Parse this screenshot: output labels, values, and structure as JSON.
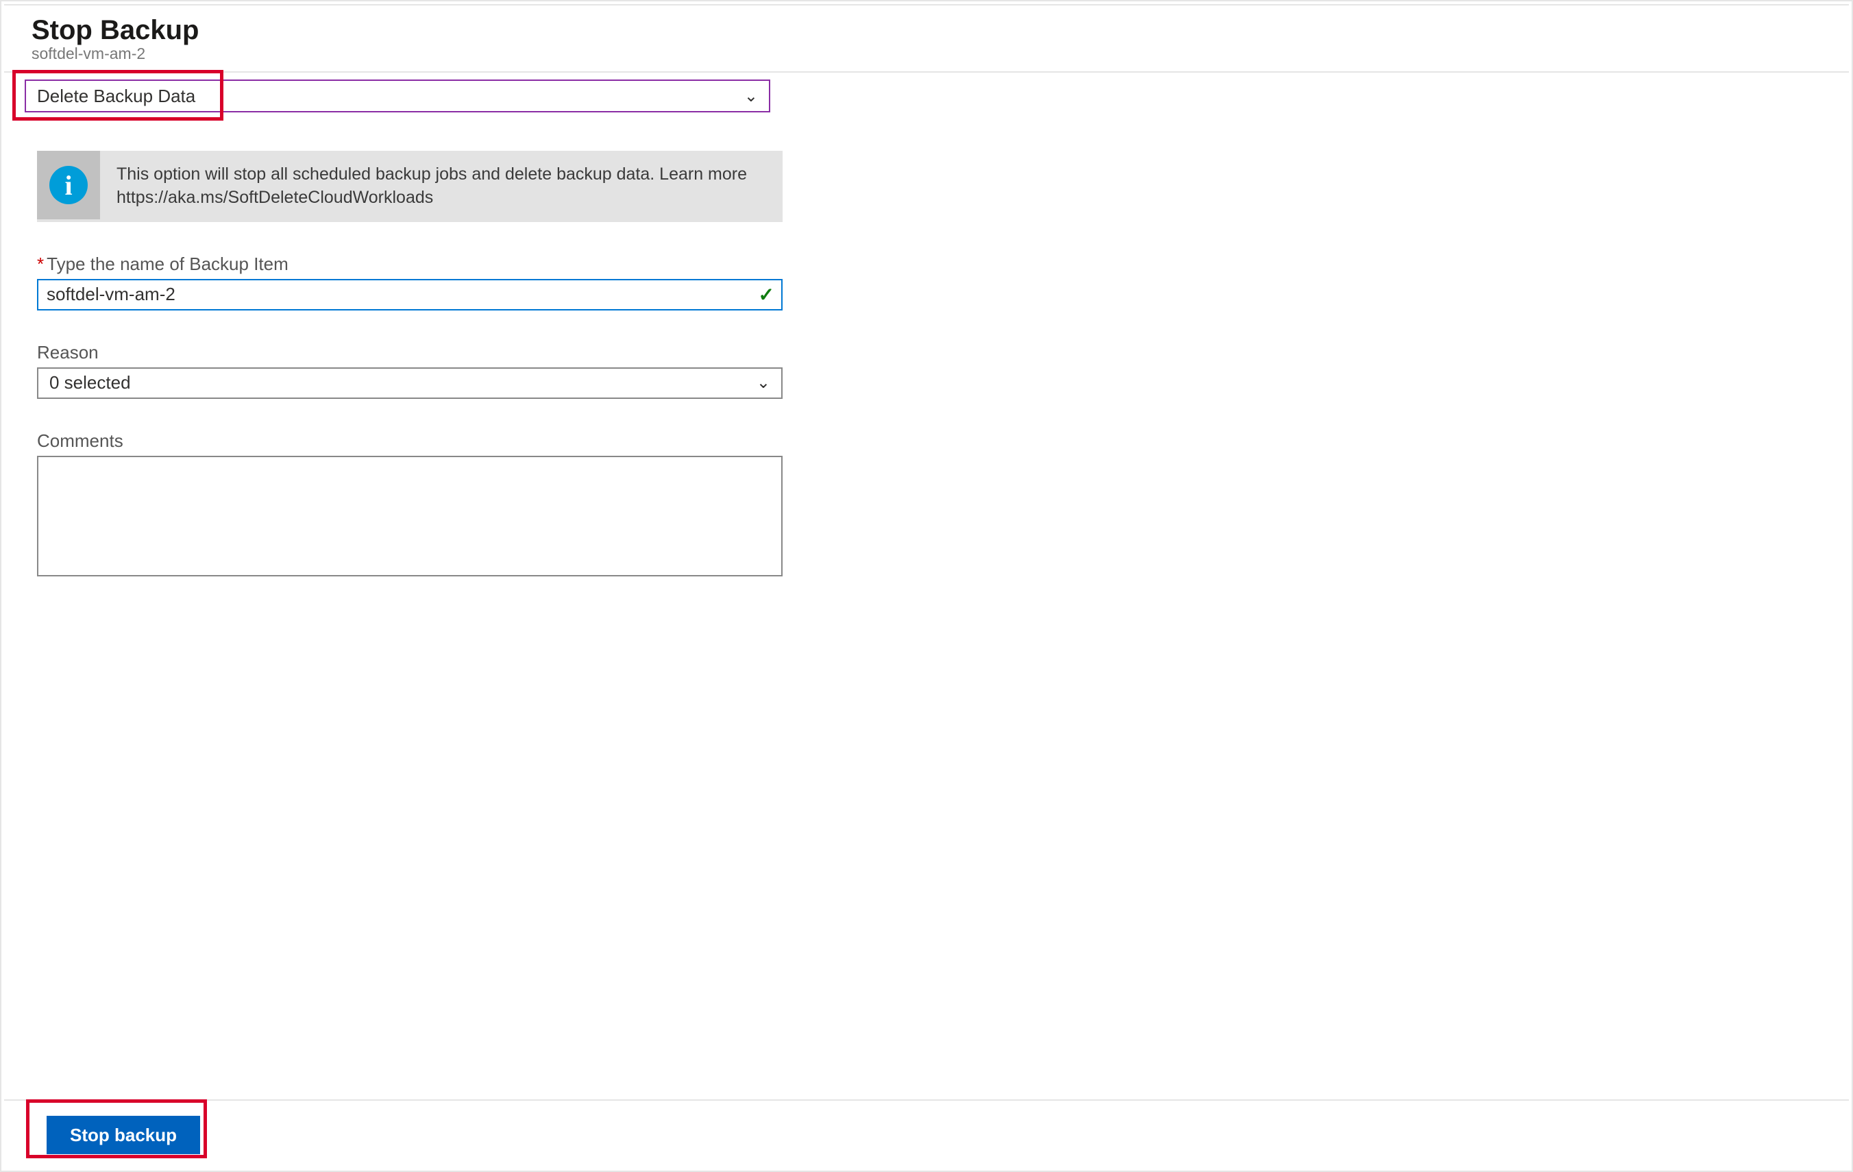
{
  "header": {
    "title": "Stop Backup",
    "subtitle": "softdel-vm-am-2"
  },
  "action_dropdown": {
    "selected": "Delete Backup Data"
  },
  "info_banner": {
    "line1": "This option will stop all scheduled backup jobs and delete backup data. Learn more",
    "line2": "https://aka.ms/SoftDeleteCloudWorkloads"
  },
  "fields": {
    "name_label": "Type the name of Backup Item",
    "name_value": "softdel-vm-am-2",
    "reason_label": "Reason",
    "reason_selected": "0 selected",
    "comments_label": "Comments",
    "comments_value": ""
  },
  "footer": {
    "stop_button": "Stop backup"
  },
  "glyphs": {
    "info": "i",
    "chevron_down": "⌄",
    "check": "✓"
  }
}
